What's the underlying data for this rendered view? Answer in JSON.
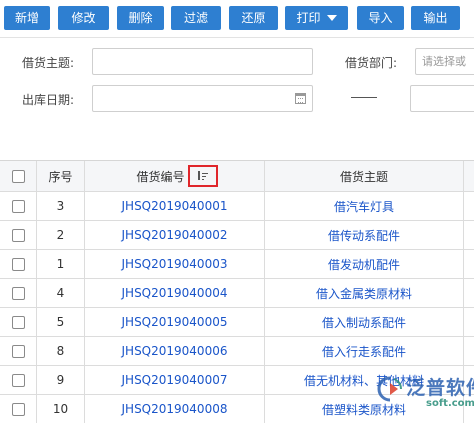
{
  "toolbar": {
    "add": "新增",
    "edit": "修改",
    "delete": "删除",
    "filter": "过滤",
    "restore": "还原",
    "print": "打印",
    "import": "导入",
    "export": "输出"
  },
  "filters": {
    "subject_label": "借货主题:",
    "subject_value": "",
    "dept_label": "借货部门:",
    "dept_placeholder": "请选择或",
    "date_label": "出库日期:",
    "date_start": "",
    "date_end": ""
  },
  "table": {
    "headers": {
      "no": "序号",
      "code": "借货编号",
      "title": "借货主题"
    },
    "rows": [
      {
        "no": "3",
        "code": "JHSQ2019040001",
        "title": "借汽车灯具"
      },
      {
        "no": "2",
        "code": "JHSQ2019040002",
        "title": "借传动系配件"
      },
      {
        "no": "1",
        "code": "JHSQ2019040003",
        "title": "借发动机配件"
      },
      {
        "no": "4",
        "code": "JHSQ2019040004",
        "title": "借入金属类原材料"
      },
      {
        "no": "5",
        "code": "JHSQ2019040005",
        "title": "借入制动系配件"
      },
      {
        "no": "8",
        "code": "JHSQ2019040006",
        "title": "借入行走系配件"
      },
      {
        "no": "9",
        "code": "JHSQ2019040007",
        "title": "借无机材料、其他材料"
      },
      {
        "no": "10",
        "code": "JHSQ2019040008",
        "title": "借塑料类原材料"
      }
    ]
  },
  "watermark": {
    "name": "泛普软件",
    "site": "soft.com"
  },
  "icons": {
    "print_menu": "chevron-down-icon",
    "date": "calendar-icon",
    "sort": "sort-icon",
    "logo": "fanpu-logo-icon"
  },
  "colors": {
    "button_bg": "#2e7fd1",
    "link": "#1a55c9",
    "highlight": "#e0262b"
  }
}
